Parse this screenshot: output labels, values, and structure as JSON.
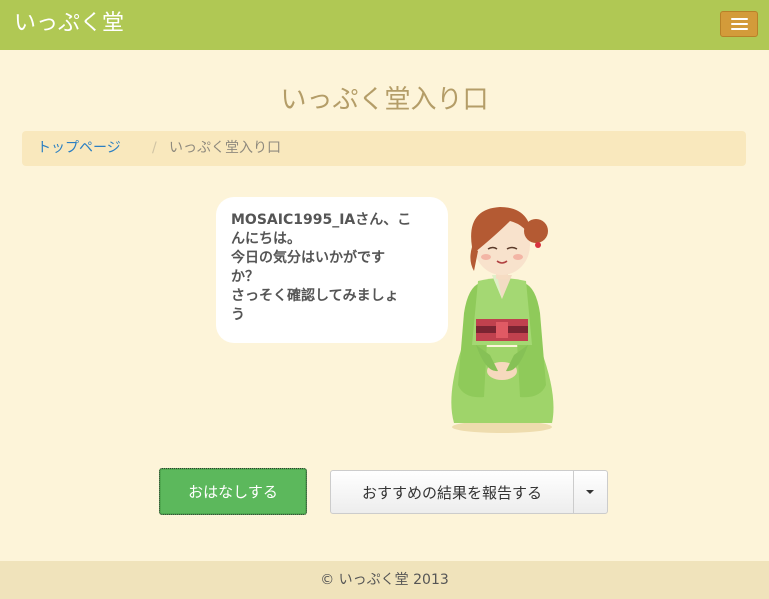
{
  "app": {
    "brand": "いっぷく堂",
    "menu_icon": "hamburger-menu-icon"
  },
  "page": {
    "title": "いっぷく堂入り口"
  },
  "breadcrumb": {
    "home_label": "トップページ",
    "separator": "/",
    "current_label": "いっぷく堂入り口"
  },
  "greeting": {
    "message": "MOSAIC1995_IAさん、こ\nんにちは。\n今日の気分はいかがです\nか？\nさっそく確認してみましょ\nう",
    "character_image": "kimono-girl-illustration"
  },
  "actions": {
    "talk_label": "おはなしする",
    "report_label": "おすすめの結果を報告する",
    "dropdown_icon": "caret-down-icon"
  },
  "footer": {
    "copyright": "© いっぷく堂 2013"
  },
  "colors": {
    "navbar": "#b0c854",
    "background": "#fdf4d9",
    "title": "#b49d68",
    "breadcrumb_bg": "#f9e8bd",
    "link": "#2b7fc2",
    "success": "#5cb85c",
    "menu_button": "#d39b3a",
    "footer_bg": "#f0e3bb"
  }
}
